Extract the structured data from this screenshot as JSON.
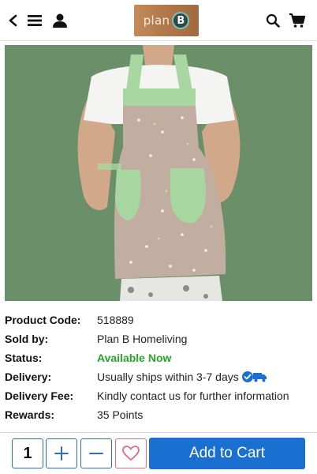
{
  "header": {
    "logo_text": "plan",
    "logo_mark": "B",
    "icons": [
      "back-arrow-icon",
      "menu-icon",
      "user-icon",
      "search-icon",
      "cart-icon"
    ]
  },
  "product": {
    "image_alt": "Apron",
    "details": [
      {
        "label": "Product Code:",
        "value": "518889"
      },
      {
        "label": "Sold by:",
        "value": "Plan B Homeliving"
      },
      {
        "label": "Status:",
        "value": "Available Now"
      },
      {
        "label": "Delivery:",
        "value": "Usually ships within 3-7 days"
      },
      {
        "label": "Delivery Fee:",
        "value": "Kindly contact us for further information"
      },
      {
        "label": "Rewards:",
        "value": "35 Points"
      }
    ]
  },
  "bottom_bar": {
    "quantity": "1",
    "increment_icon": "plus-icon",
    "decrement_icon": "minus-icon",
    "wishlist_icon": "heart-icon",
    "add_to_cart_label": "Add to Cart"
  },
  "colors": {
    "primary": "#1b6fd1",
    "status_available": "#2aa52a",
    "wishlist": "#e06a7f"
  }
}
